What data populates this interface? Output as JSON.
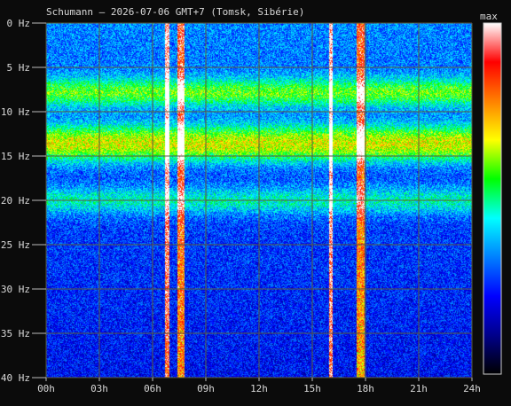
{
  "chart_data": {
    "type": "heatmap",
    "title": "Schumann — 2026-07-06 GMT+7  (Tomsk, Sibérie)",
    "x_ticks": [
      "00h",
      "03h",
      "06h",
      "09h",
      "12h",
      "15h",
      "18h",
      "21h",
      "24h"
    ],
    "y_ticks": [
      "0 Hz",
      "5 Hz",
      "10 Hz",
      "15 Hz",
      "20 Hz",
      "25 Hz",
      "30 Hz",
      "35 Hz",
      "40 Hz"
    ],
    "xlim": [
      0,
      24
    ],
    "ylim": [
      0,
      40
    ],
    "x_unit": "h",
    "y_unit": "Hz",
    "colorbar_label": "max",
    "colormap": [
      "#000000",
      "#00008b",
      "#0000ff",
      "#0080ff",
      "#00ffff",
      "#00ff00",
      "#ffff00",
      "#ff8000",
      "#ff0000",
      "#ffffff"
    ],
    "resonance_bands_hz": [
      {
        "freq": 7.8,
        "intensity": 0.6
      },
      {
        "freq": 14.3,
        "intensity": 0.55
      },
      {
        "freq": 20.0,
        "intensity": 0.4
      },
      {
        "freq": 12.7,
        "intensity": 0.5
      }
    ],
    "bursts": [
      {
        "start_h": 6.7,
        "end_h": 6.9,
        "intensity": 0.95
      },
      {
        "start_h": 7.4,
        "end_h": 7.8,
        "intensity": 0.8
      },
      {
        "start_h": 15.9,
        "end_h": 16.1,
        "intensity": 1.0
      },
      {
        "start_h": 17.5,
        "end_h": 17.9,
        "intensity": 0.75
      }
    ]
  }
}
